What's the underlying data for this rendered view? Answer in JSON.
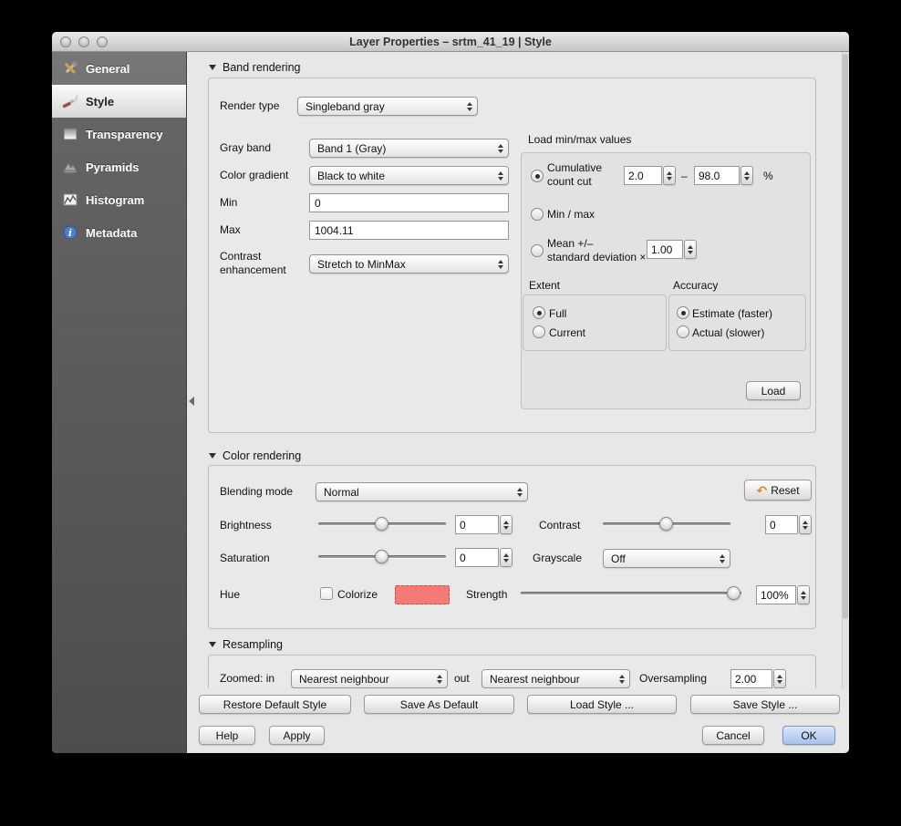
{
  "window": {
    "title": "Layer Properties – srtm_41_19 | Style"
  },
  "sidebar": {
    "items": [
      {
        "label": "General"
      },
      {
        "label": "Style"
      },
      {
        "label": "Transparency"
      },
      {
        "label": "Pyramids"
      },
      {
        "label": "Histogram"
      },
      {
        "label": "Metadata"
      }
    ]
  },
  "band_rendering": {
    "header": "Band rendering",
    "render_type_label": "Render type",
    "render_type_value": "Singleband gray",
    "gray_band_label": "Gray band",
    "gray_band_value": "Band 1 (Gray)",
    "color_gradient_label": "Color gradient",
    "color_gradient_value": "Black to white",
    "min_label": "Min",
    "min_value": "0",
    "max_label": "Max",
    "max_value": "1004.11",
    "contrast_label_line1": "Contrast",
    "contrast_label_line2": "enhancement",
    "contrast_value": "Stretch to MinMax"
  },
  "load_minmax": {
    "title": "Load min/max values",
    "cumulative_line1": "Cumulative",
    "cumulative_line2": "count cut",
    "cumulative_min": "2.0",
    "separator": "–",
    "cumulative_max": "98.0",
    "percent": "%",
    "minmax_label": "Min / max",
    "mean_line1": "Mean +/–",
    "mean_line2": "standard deviation ×",
    "mean_value": "1.00",
    "extent_title": "Extent",
    "extent_full": "Full",
    "extent_current": "Current",
    "accuracy_title": "Accuracy",
    "accuracy_estimate": "Estimate (faster)",
    "accuracy_actual": "Actual (slower)",
    "load_button": "Load"
  },
  "color_rendering": {
    "header": "Color rendering",
    "blending_label": "Blending mode",
    "blending_value": "Normal",
    "reset_button": "Reset",
    "brightness_label": "Brightness",
    "brightness_value": "0",
    "contrast_label": "Contrast",
    "contrast_value": "0",
    "saturation_label": "Saturation",
    "saturation_value": "0",
    "grayscale_label": "Grayscale",
    "grayscale_value": "Off",
    "hue_label": "Hue",
    "colorize_label": "Colorize",
    "swatch_color": "#f37a76",
    "strength_label": "Strength",
    "strength_value": "100%"
  },
  "resampling": {
    "header": "Resampling",
    "zoomed_in_label": "Zoomed: in",
    "zoomed_in_value": "Nearest neighbour",
    "out_label": "out",
    "zoomed_out_value": "Nearest neighbour",
    "oversampling_label": "Oversampling",
    "oversampling_value": "2.00"
  },
  "footer": {
    "restore_default_style": "Restore Default Style",
    "save_as_default": "Save As Default",
    "load_style": "Load Style ...",
    "save_style": "Save Style ...",
    "help": "Help",
    "apply": "Apply",
    "cancel": "Cancel",
    "ok": "OK"
  },
  "icons": {
    "reset": "↶"
  }
}
